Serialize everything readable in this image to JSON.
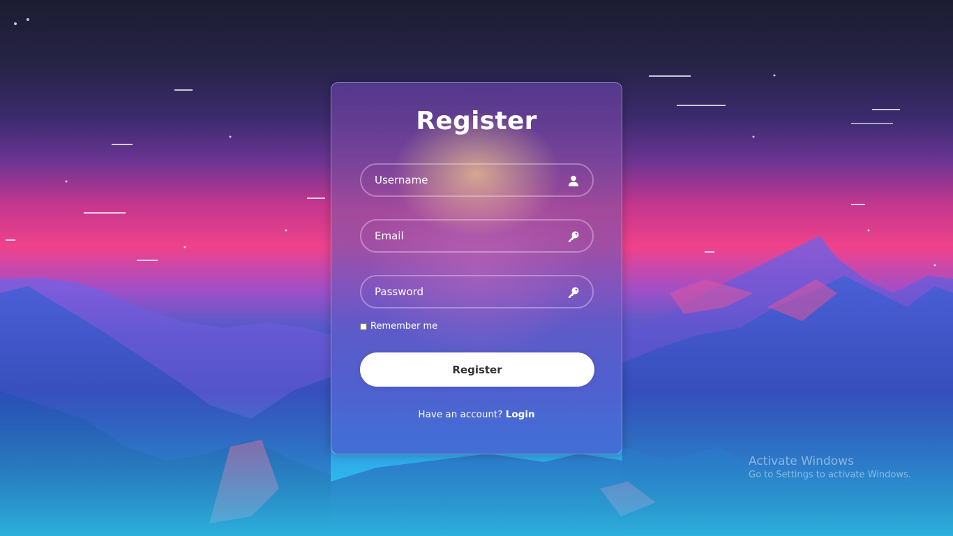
{
  "form": {
    "title": "Register",
    "username_placeholder": "Username",
    "email_placeholder": "Email",
    "password_placeholder": "Password",
    "remember_label": "Remember me",
    "remember_checked": false,
    "submit_label": "Register",
    "account_text": "Have an account?",
    "login_link": "Login"
  },
  "icons": {
    "username": "user-icon",
    "email": "key-icon",
    "password": "key-icon"
  },
  "watermark": {
    "title": "Activate Windows",
    "subtitle": "Go to Settings to activate Windows."
  },
  "colors": {
    "button_bg": "#ffffff",
    "button_text": "#333333",
    "text": "#ffffff"
  }
}
